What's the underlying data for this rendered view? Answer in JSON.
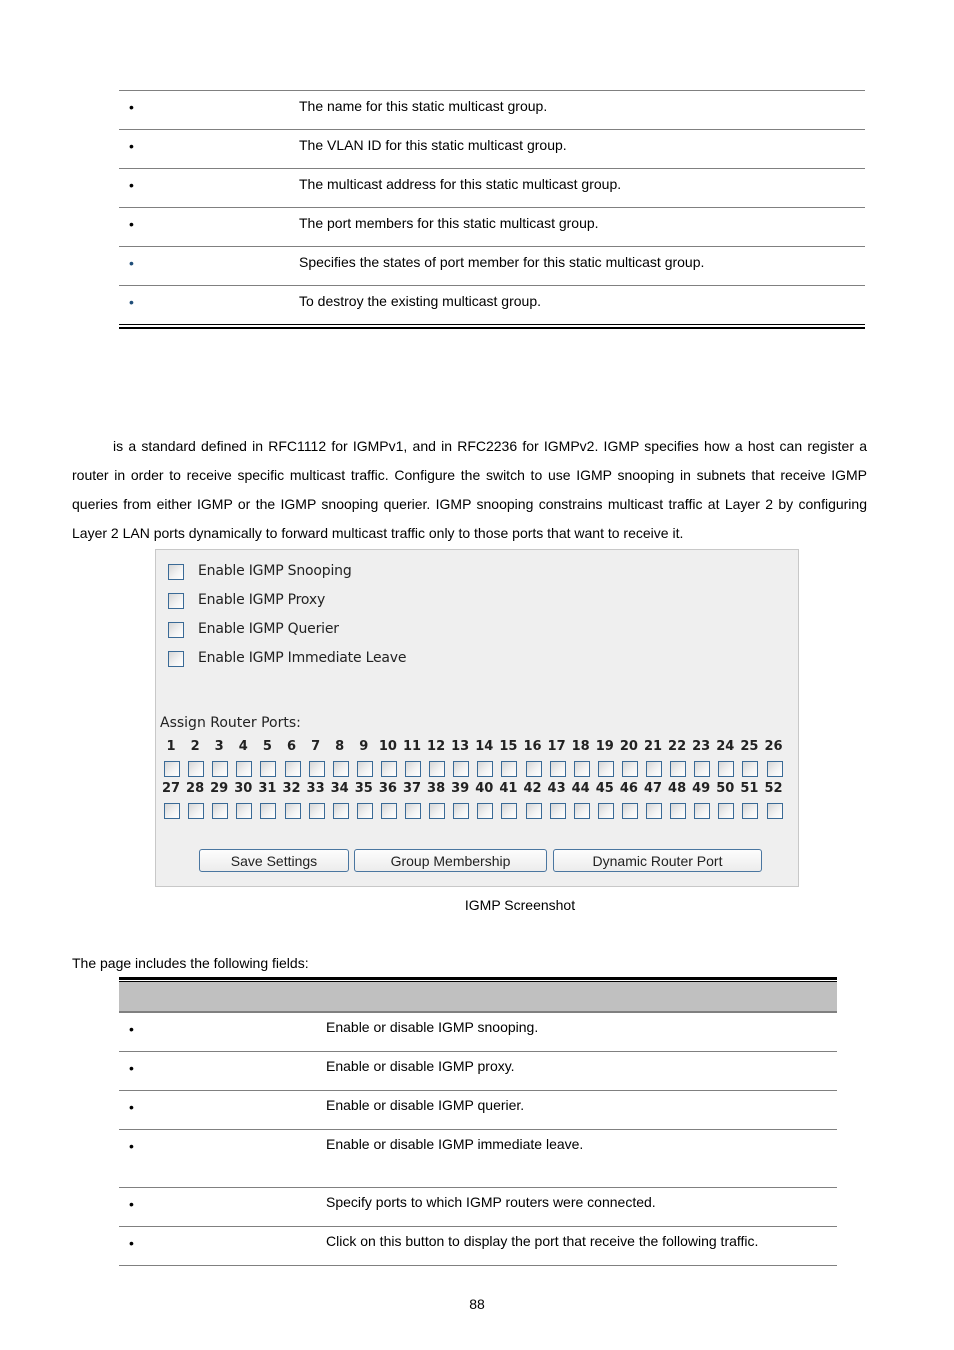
{
  "top_table": {
    "rows": [
      {
        "bullet": "•",
        "description": "The name for this static multicast group."
      },
      {
        "bullet": "•",
        "description": "The VLAN ID for this static multicast group."
      },
      {
        "bullet": "•",
        "description": "The multicast address for this static multicast group."
      },
      {
        "bullet": "•",
        "description": "The port members for this static multicast group."
      },
      {
        "bullet": "•",
        "description": "Specifies the states of port member for this static multicast group."
      },
      {
        "bullet": "•",
        "description": "To destroy the existing multicast group."
      }
    ]
  },
  "intro_paragraph": "is a standard defined in RFC1112 for IGMPv1, and in RFC2236 for IGMPv2. IGMP specifies how a host can register a router in order to receive specific multicast traffic. Configure the switch to use IGMP snooping in subnets that receive IGMP queries from either IGMP or the IGMP snooping querier. IGMP snooping constrains multicast traffic at Layer 2 by configuring Layer 2 LAN ports dynamically to forward multicast traffic only to those ports that want to receive it.",
  "igmp_panel": {
    "options": [
      {
        "label": "Enable IGMP Snooping",
        "checked": false
      },
      {
        "label": "Enable IGMP Proxy",
        "checked": false
      },
      {
        "label": "Enable IGMP Querier",
        "checked": false
      },
      {
        "label": "Enable IGMP Immediate Leave",
        "checked": false
      }
    ],
    "assign_router_ports_label": "Assign Router Ports:",
    "ports_row1": [
      "1",
      "2",
      "3",
      "4",
      "5",
      "6",
      "7",
      "8",
      "9",
      "10",
      "11",
      "12",
      "13",
      "14",
      "15",
      "16",
      "17",
      "18",
      "19",
      "20",
      "21",
      "22",
      "23",
      "24",
      "25",
      "26"
    ],
    "ports_row2": [
      "27",
      "28",
      "29",
      "30",
      "31",
      "32",
      "33",
      "34",
      "35",
      "36",
      "37",
      "38",
      "39",
      "40",
      "41",
      "42",
      "43",
      "44",
      "45",
      "46",
      "47",
      "48",
      "49",
      "50",
      "51",
      "52"
    ],
    "buttons": {
      "save": "Save Settings",
      "group_membership": "Group Membership",
      "dynamic_router_port": "Dynamic Router Port"
    }
  },
  "figure_caption": "IGMP Screenshot",
  "fields_intro": "The page includes the following fields:",
  "fields_table": {
    "rows": [
      {
        "bullet": "•",
        "description": "Enable or disable IGMP snooping."
      },
      {
        "bullet": "•",
        "description": "Enable or disable IGMP proxy."
      },
      {
        "bullet": "•",
        "description": "Enable or disable IGMP querier."
      },
      {
        "bullet": "•",
        "description": "Enable or disable IGMP immediate leave."
      },
      {
        "bullet": "•",
        "description": "Specify ports to which IGMP routers were connected."
      },
      {
        "bullet": "•",
        "description": "Click on this button to display the port that receive the following traffic."
      }
    ]
  },
  "page_number": "88"
}
